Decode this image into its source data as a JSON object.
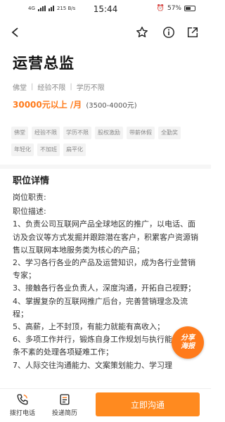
{
  "status_bar": {
    "network": "4G",
    "speed": "215 B/s",
    "time": "15:44",
    "battery": "57%"
  },
  "nav": {
    "icons": [
      "back-arrow-icon",
      "star-icon",
      "info-icon",
      "share-icon"
    ]
  },
  "job": {
    "title": "运营总监",
    "meta": [
      "佛堂",
      "经验不限",
      "学历不限"
    ],
    "salary_main": "30000元以上 /月",
    "salary_range": "(3500-4000元)",
    "tags": [
      "佛堂",
      "经验不限",
      "学历不限",
      "股权激励",
      "带薪休假",
      "全勤奖",
      "年轻化",
      "不加班",
      "扁平化"
    ]
  },
  "details": {
    "section_title": "职位详情",
    "duty_label": "岗位职责:",
    "desc_label": "职位描述:",
    "lines": [
      "1、负责公司互联网产品全球地区的推广，以电话、面访及会议等方式发掘并跟踪潜在客户，积累客户资源销售以互联网本地服务类为核心的产品；",
      "2、学习各行各业的产品及运营知识，成为各行业营销专家；",
      "3、接触各行各业负责人，深度沟通，开拓自己视野；",
      "4、掌握复杂的互联网推广后台，完善营销理念及流程；",
      "5、高薪，上不封顶，有能力就能有高收入；",
      "6、多项工作并行，锻炼自身工作规划与执行能力，有条不紊的处理各项疑难工作；",
      "7、人际交往沟通能力、文案策划能力、学习理"
    ]
  },
  "floating": {
    "line1": "分享",
    "line2": "海报"
  },
  "bottom": {
    "call_label": "拨打电话",
    "resume_label": "投递简历",
    "primary_label": "立即沟通"
  },
  "colors": {
    "accent": "#ff7a1a",
    "primary_button": "#ff8a1f"
  }
}
